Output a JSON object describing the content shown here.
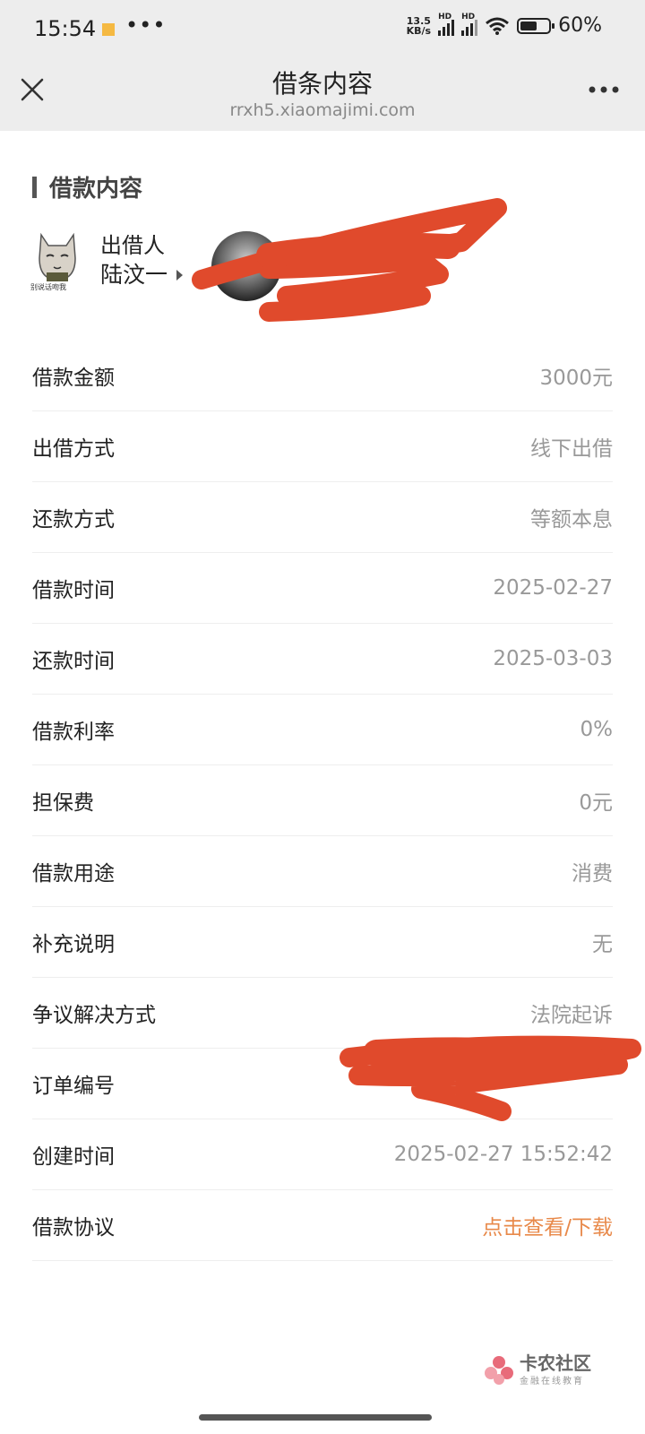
{
  "status_bar": {
    "time": "15:54",
    "dots": "•••",
    "net_speed_value": "13.5",
    "net_speed_unit": "KB/s",
    "signal_tag": "HD",
    "battery_level": 0.6,
    "battery_text": "60%"
  },
  "title_bar": {
    "title": "借条内容",
    "url": "rrxh5.xiaomajimi.com"
  },
  "section": {
    "title": "借款内容"
  },
  "lender": {
    "role": "出借人",
    "name": "陆汶一",
    "avatar_caption": "别说话吻我"
  },
  "rows": [
    {
      "label": "借款金额",
      "value": "3000元"
    },
    {
      "label": "出借方式",
      "value": "线下出借"
    },
    {
      "label": "还款方式",
      "value": "等额本息"
    },
    {
      "label": "借款时间",
      "value": "2025-02-27"
    },
    {
      "label": "还款时间",
      "value": "2025-03-03"
    },
    {
      "label": "借款利率",
      "value": "0%"
    },
    {
      "label": "担保费",
      "value": "0元"
    },
    {
      "label": "借款用途",
      "value": "消费"
    },
    {
      "label": "补充说明",
      "value": "无"
    },
    {
      "label": "争议解决方式",
      "value": "法院起诉"
    },
    {
      "label": "订单编号",
      "value": ""
    },
    {
      "label": "创建时间",
      "value": "2025-02-27 15:52:42"
    },
    {
      "label": "借款协议",
      "value": "点击查看/下载"
    }
  ],
  "watermark": {
    "title": "卡农社区",
    "subtitle": "金融在线教育"
  },
  "colors": {
    "link": "#e8894a",
    "redaction": "#e04a2c"
  }
}
